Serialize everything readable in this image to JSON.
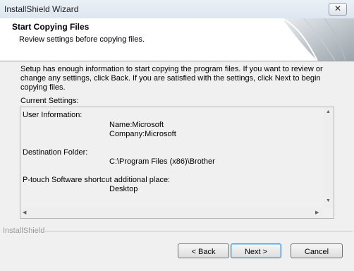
{
  "window": {
    "title": "InstallShield Wizard",
    "close_glyph": "✕"
  },
  "header": {
    "title": "Start Copying Files",
    "subtitle": "Review settings before copying files."
  },
  "intro": {
    "lines": [
      "Setup has enough information to start copying the program files.  If you want to review or",
      "change any settings, click Back.  If you are satisfied with the settings, click Next to begin",
      "copying files."
    ]
  },
  "settings": {
    "label": "Current Settings:",
    "lines": [
      "User Information:",
      "Name:Microsoft",
      "Company:Microsoft",
      "Destination Folder:",
      "C:\\Program Files (x86)\\Brother",
      "P-touch Software shortcut additional place:",
      "Desktop"
    ]
  },
  "footer": {
    "brand": "InstallShield"
  },
  "buttons": {
    "back": "< Back",
    "next": "Next >",
    "cancel": "Cancel"
  },
  "icons": {
    "scroll_up": "▲",
    "scroll_down": "▼",
    "scroll_left": "◀",
    "scroll_right": "▶"
  }
}
